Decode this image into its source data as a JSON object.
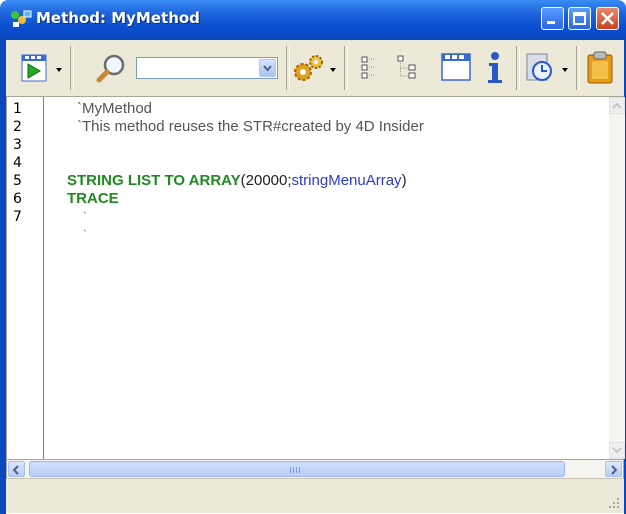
{
  "window": {
    "title": "Method: MyMethod"
  },
  "toolbar": {
    "run_icon": "run-method-icon",
    "search_icon": "magnifier-icon",
    "search_value": "",
    "settings_icon": "gears-icon",
    "icons": [
      "collapse-all-icon",
      "expand-all-icon",
      "window-icon",
      "info-icon",
      "clock-icon",
      "clipboard-icon"
    ]
  },
  "editor": {
    "line_numbers": [
      "1",
      "2",
      "3",
      "4",
      "5",
      "6",
      "7"
    ],
    "lines": {
      "l1": "`MyMethod",
      "l2": "`This method reuses the STR#created by 4D Insider",
      "l4_kw": "STRING LIST TO ARRAY",
      "l4_args_a": "(20000;",
      "l4_var": "stringMenuArray",
      "l4_args_b": ")",
      "l5_kw": "TRACE",
      "l6": "`",
      "l7": "`"
    }
  },
  "colors": {
    "titlebar": "#0b47bd",
    "keyword": "#1f8a1f",
    "variable": "#2a3cd0",
    "comment": "#555555"
  }
}
